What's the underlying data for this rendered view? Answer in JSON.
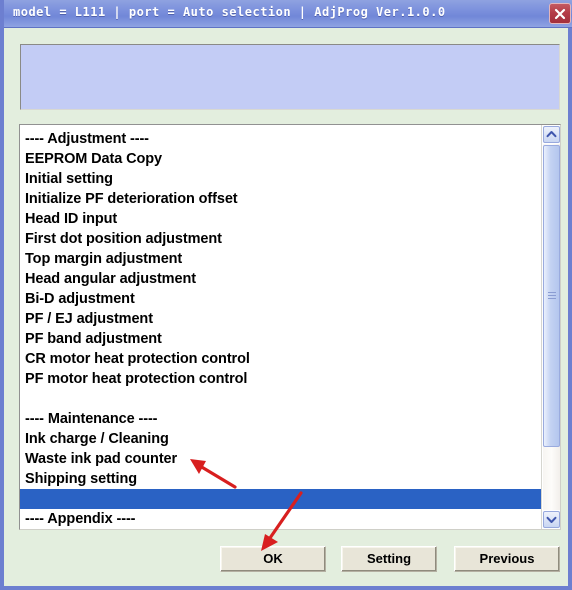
{
  "window": {
    "title": "model = L111 | port = Auto selection | AdjProg Ver.1.0.0",
    "close_icon": "close-icon",
    "background_color": "#e3eede",
    "border_color": "#6d7fd0",
    "titlebar_color": "#7d92dd"
  },
  "info_panel": {
    "text": "",
    "background_color": "#c3ccf5"
  },
  "list": {
    "selected_index": 18,
    "selection_color": "#2a62c4",
    "items": [
      {
        "label": "---- Adjustment ----",
        "type": "header"
      },
      {
        "label": "EEPROM Data Copy",
        "type": "item"
      },
      {
        "label": "Initial setting",
        "type": "item"
      },
      {
        "label": "Initialize PF deterioration offset",
        "type": "item"
      },
      {
        "label": "Head ID input",
        "type": "item"
      },
      {
        "label": "First dot position adjustment",
        "type": "item"
      },
      {
        "label": "Top margin adjustment",
        "type": "item"
      },
      {
        "label": "Head angular adjustment",
        "type": "item"
      },
      {
        "label": "Bi-D adjustment",
        "type": "item"
      },
      {
        "label": "PF / EJ adjustment",
        "type": "item"
      },
      {
        "label": "PF band adjustment",
        "type": "item"
      },
      {
        "label": "CR motor heat protection control",
        "type": "item"
      },
      {
        "label": "PF motor heat protection control",
        "type": "item"
      },
      {
        "label": "",
        "type": "spacer"
      },
      {
        "label": "---- Maintenance ----",
        "type": "header"
      },
      {
        "label": "Ink charge / Cleaning",
        "type": "item"
      },
      {
        "label": "Waste ink pad counter",
        "type": "item"
      },
      {
        "label": "Shipping setting",
        "type": "item"
      },
      {
        "label": "",
        "type": "spacer"
      },
      {
        "label": "---- Appendix ----",
        "type": "header"
      }
    ]
  },
  "scrollbar": {
    "up_icon": "chevron-up-icon",
    "down_icon": "chevron-down-icon",
    "thumb_color": "#c3d2f2"
  },
  "buttons": {
    "ok": "OK",
    "setting": "Setting",
    "previous": "Previous"
  },
  "annotations": {
    "color": "#d81f1f",
    "arrow_1_target": "Waste ink pad counter",
    "arrow_2_target": "OK"
  }
}
